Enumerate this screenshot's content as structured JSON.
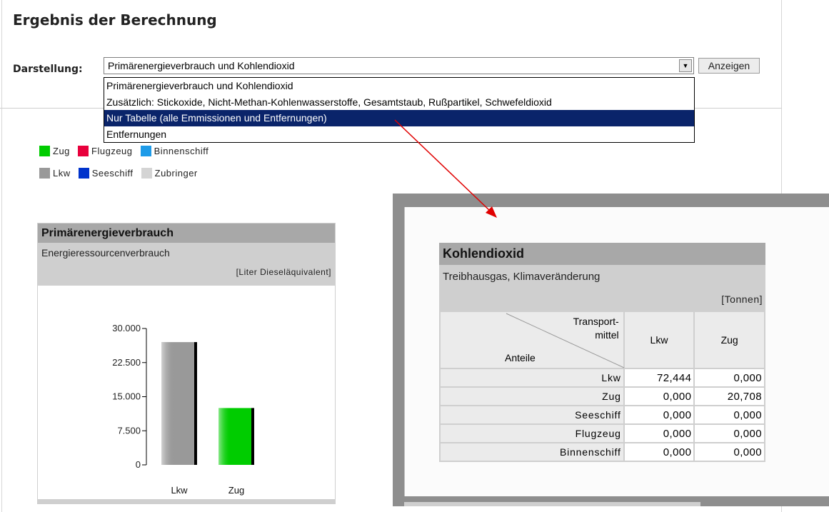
{
  "page": {
    "title": "Ergebnis der Berechnung"
  },
  "controls": {
    "darstellung_label": "Darstellung:",
    "selected": "Primärenergieverbrauch und Kohlendioxid",
    "anzeigen_label": "Anzeigen",
    "dropdown_options": [
      "Primärenergieverbrauch und Kohlendioxid",
      "Zusätzlich: Stickoxide, Nicht-Methan-Kohlenwasserstoffe, Gesamtstaub, Rußpartikel, Schwefeldioxid",
      "Nur Tabelle (alle Emmissionen und Entfernungen)",
      "Entfernungen"
    ],
    "highlighted_index": 2
  },
  "legend": [
    {
      "label": "Zug",
      "color": "#00cc00"
    },
    {
      "label": "Flugzeug",
      "color": "#e8003c"
    },
    {
      "label": "Binnenschiff",
      "color": "#1e9be8"
    },
    {
      "label": "Lkw",
      "color": "#999999"
    },
    {
      "label": "Seeschiff",
      "color": "#0033cc"
    },
    {
      "label": "Zubringer",
      "color": "#d4d4d4"
    }
  ],
  "energy_panel": {
    "title": "Primärenergieverbrauch",
    "subtitle": "Energieressourcenverbrauch",
    "unit": "[Liter Dieseläquivalent]"
  },
  "chart_data": {
    "type": "bar",
    "title": "Primärenergieverbrauch",
    "categories": [
      "Lkw",
      "Zug"
    ],
    "values": [
      27000,
      12500
    ],
    "colors": [
      "#999999",
      "#00cc00"
    ],
    "yticks": [
      "30.000",
      "22.500",
      "15.000",
      "7.500",
      "0"
    ],
    "ylim": [
      0,
      30000
    ],
    "ylabel": "[Liter Dieseläquivalent]"
  },
  "co2_panel": {
    "title": "Kohlendioxid",
    "subtitle": "Treibhausgas, Klimaveränderung",
    "unit": "[Tonnen]",
    "corner_top": [
      "Transport-",
      "mittel"
    ],
    "corner_bottom": "Anteile",
    "columns": [
      "Lkw",
      "Zug"
    ],
    "rows": [
      {
        "label": "Lkw",
        "values": [
          "72,444",
          "0,000"
        ]
      },
      {
        "label": "Zug",
        "values": [
          "0,000",
          "20,708"
        ]
      },
      {
        "label": "Seeschiff",
        "values": [
          "0,000",
          "0,000"
        ]
      },
      {
        "label": "Flugzeug",
        "values": [
          "0,000",
          "0,000"
        ]
      },
      {
        "label": "Binnenschiff",
        "values": [
          "0,000",
          "0,000"
        ]
      }
    ]
  },
  "annotation": {
    "arrow_color": "#e00000"
  }
}
